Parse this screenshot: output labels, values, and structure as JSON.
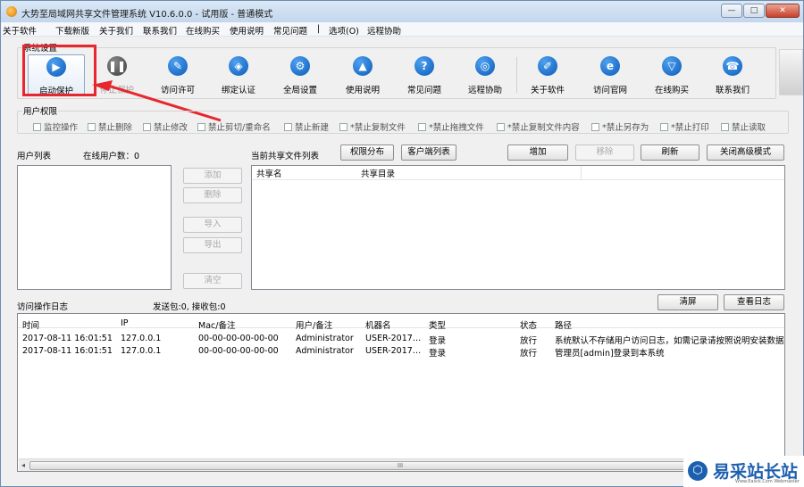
{
  "window": {
    "title": "大势至局域网共享文件管理系统 V10.6.0.0 - 试用版 - 普通模式",
    "controls": {
      "minimize": "—",
      "maximize": "□",
      "close": "✕"
    }
  },
  "menu": [
    "关于软件",
    "下载新版",
    "关于我们",
    "联系我们",
    "在线购买",
    "使用说明",
    "常见问题",
    "|",
    "选项(O)",
    "远程协助"
  ],
  "system_settings": {
    "label": "系统设置",
    "tools": [
      {
        "label": "启动保护",
        "icon": "play-icon",
        "glyph": "▶"
      },
      {
        "label": "停止保护",
        "icon": "pause-icon",
        "glyph": "❚❚"
      },
      {
        "label": "访问许可",
        "icon": "key-icon",
        "glyph": "✎"
      },
      {
        "label": "绑定认证",
        "icon": "shield-icon",
        "glyph": "◈"
      },
      {
        "label": "全局设置",
        "icon": "gear-icon",
        "glyph": "⚙"
      },
      {
        "label": "使用说明",
        "icon": "graduation-cap-icon",
        "glyph": "▲"
      },
      {
        "label": "常见问题",
        "icon": "question-icon",
        "glyph": "?"
      },
      {
        "label": "远程协助",
        "icon": "globe-icon",
        "glyph": "◎"
      },
      {
        "label": "关于软件",
        "icon": "edit-icon",
        "glyph": "✐"
      },
      {
        "label": "访问官网",
        "icon": "browser-icon",
        "glyph": "e"
      },
      {
        "label": "在线购买",
        "icon": "cart-icon",
        "glyph": "▽"
      },
      {
        "label": "联系我们",
        "icon": "phone-icon",
        "glyph": "☎"
      }
    ]
  },
  "user_permissions": {
    "label": "用户权限",
    "items": [
      "监控操作",
      "禁止删除",
      "禁止修改",
      "禁止剪切/重命名",
      "禁止新建",
      "*禁止复制文件",
      "*禁止拖拽文件",
      "*禁止复制文件内容",
      "*禁止另存为",
      "*禁止打印",
      "禁止读取"
    ]
  },
  "user_list": {
    "title": "用户列表",
    "online_label": "在线用户数：0"
  },
  "side_buttons": {
    "add": "添加",
    "delete": "删除",
    "import": "导入",
    "export": "导出",
    "clear": "清空"
  },
  "share_list": {
    "title": "当前共享文件列表",
    "perm_button": "权限分布",
    "client_button": "客户端列表",
    "add_button": "增加",
    "remove_button": "移除",
    "refresh_button": "刷新",
    "close_advanced_button": "关闭高级模式",
    "columns": [
      "共享名",
      "共享目录"
    ]
  },
  "log": {
    "title": "访问操作日志",
    "packets": "发送包:0, 接收包:0",
    "clear_button": "清屏",
    "view_button": "查看日志",
    "columns": [
      "时间",
      "IP",
      "Mac/备注",
      "用户/备注",
      "机器名",
      "类型",
      "状态",
      "路径"
    ],
    "rows": [
      [
        "2017-08-11 16:01:51",
        "127.0.0.1",
        "00-00-00-00-00-00",
        "Administrator",
        "USER-2017…",
        "登录",
        "放行",
        "系统默认不存储用户访问日志，如需记录请按照说明安装数据库"
      ],
      [
        "2017-08-11 16:01:51",
        "127.0.0.1",
        "00-00-00-00-00-00",
        "Administrator",
        "USER-2017…",
        "登录",
        "放行",
        "管理员[admin]登录到本系统"
      ]
    ]
  },
  "scrollbar": {
    "grip": "III",
    "left": "◂",
    "right": "▸"
  },
  "watermark": {
    "logo": "⬡",
    "text": "易采站长站",
    "sub": "Www.Easck.Com Webmaster"
  },
  "colors": {
    "highlight": "#e8262d",
    "icon_blue": "#0a5bb8",
    "watermark_blue": "#1b5fae"
  }
}
